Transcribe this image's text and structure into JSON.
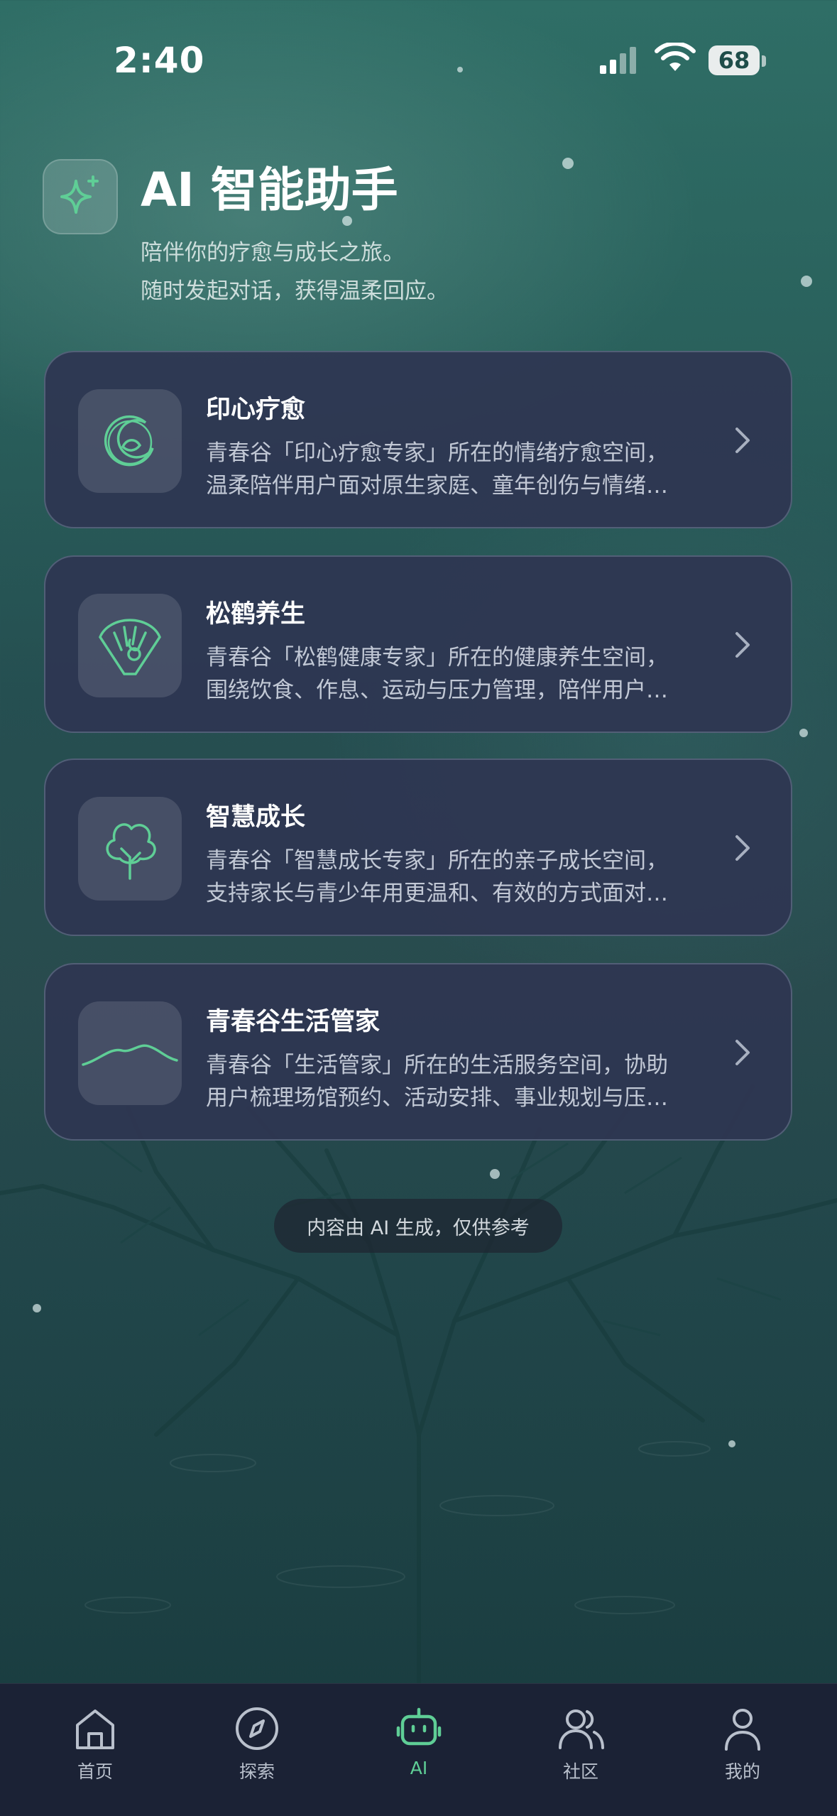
{
  "status_bar": {
    "time": "2:40",
    "battery": "68"
  },
  "header": {
    "title": "AI 智能助手",
    "subtitle_line1": "陪伴你的疗愈与成长之旅。",
    "subtitle_line2": "随时发起对话，获得温柔回应。"
  },
  "cards": [
    {
      "title": "印心疗愈",
      "desc1": "青春谷「印心疗愈专家」所在的情绪疗愈空间，",
      "desc2": "温柔陪伴用户面对原生家庭、童年创伤与情绪…",
      "icon": "moon-leaf-icon"
    },
    {
      "title": "松鹤养生",
      "desc1": "青春谷「松鹤健康专家」所在的健康养生空间，",
      "desc2": "围绕饮食、作息、运动与压力管理，陪伴用户…",
      "icon": "fan-crane-icon"
    },
    {
      "title": "智慧成长",
      "desc1": "青春谷「智慧成长专家」所在的亲子成长空间，",
      "desc2": "支持家长与青少年用更温和、有效的方式面对…",
      "icon": "tree-icon"
    },
    {
      "title": "青春谷生活管家",
      "desc1": "青春谷「生活管家」所在的生活服务空间，协助",
      "desc2": "用户梳理场馆预约、活动安排、事业规划与压…",
      "icon": "mountain-icon"
    }
  ],
  "disclaimer": "内容由 AI 生成，仅供参考",
  "tabs": [
    {
      "label": "首页",
      "icon": "home-icon"
    },
    {
      "label": "探索",
      "icon": "compass-icon"
    },
    {
      "label": "AI",
      "icon": "robot-icon",
      "active": true
    },
    {
      "label": "社区",
      "icon": "users-icon"
    },
    {
      "label": "我的",
      "icon": "user-icon"
    }
  ],
  "colors": {
    "accent": "#5fce96",
    "card_bg": "#2e3652",
    "tabbar_bg": "#1b2235"
  }
}
